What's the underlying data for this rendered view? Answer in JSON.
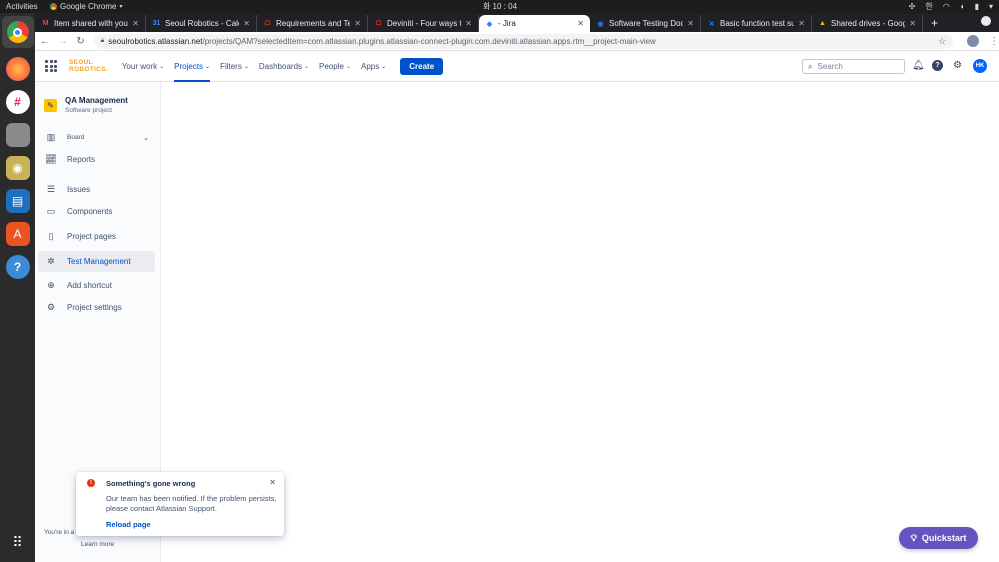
{
  "os": {
    "activities": "Activities",
    "app_name": "Google Chrome",
    "clock": "화 10 : 04",
    "lang": "한"
  },
  "tabs": [
    {
      "title": "Item shared with you",
      "favicon": "M",
      "color": "#ea4335"
    },
    {
      "title": "Seoul Robotics - Calen",
      "favicon": "31",
      "color": "#4285f4"
    },
    {
      "title": "Requirements and Te",
      "favicon": "ᗝ",
      "color": "#e2261d"
    },
    {
      "title": "Deviniti - Four ways t",
      "favicon": "ᗝ",
      "color": "#e2261d"
    },
    {
      "title": "- Jira",
      "favicon": "◆",
      "color": "#2684ff",
      "active": true
    },
    {
      "title": "Software Testing Doc",
      "favicon": "◉",
      "color": "#1a73e8"
    },
    {
      "title": "Basic function test su",
      "favicon": "✕",
      "color": "#2684ff"
    },
    {
      "title": "Shared drives - Googl",
      "favicon": "▲",
      "color": "#fbbc04"
    }
  ],
  "address": {
    "domain": "seoulrobotics.atlassian.net",
    "path": "/projects/QAM?selectedItem=com.atlassian.plugins.atlassian-connect-plugin:com.deviniti.atlassian.apps.rtm__project-main-view"
  },
  "header": {
    "logo_line1": "SEOUL",
    "logo_line2": "ROBOTICS.",
    "nav": [
      {
        "label": "Your work"
      },
      {
        "label": "Projects",
        "active": true
      },
      {
        "label": "Filters"
      },
      {
        "label": "Dashboards"
      },
      {
        "label": "People"
      },
      {
        "label": "Apps"
      }
    ],
    "create_label": "Create",
    "search_placeholder": "Search",
    "avatar_initials": "HK"
  },
  "sidebar": {
    "project_name": "QA Management",
    "project_type": "Software project",
    "items": [
      {
        "label": "Board",
        "icon": "board-icon"
      },
      {
        "label": "Reports",
        "icon": "chart-icon"
      },
      {
        "label": "Issues",
        "icon": "issues-icon"
      },
      {
        "label": "Components",
        "icon": "components-icon"
      },
      {
        "label": "Project pages",
        "icon": "page-icon"
      },
      {
        "label": "Test Management",
        "icon": "bug-icon",
        "selected": true
      },
      {
        "label": "Add shortcut",
        "icon": "add-shortcut-icon"
      },
      {
        "label": "Project settings",
        "icon": "gear-icon"
      }
    ],
    "footer_text": "You're in a c",
    "learn_more": "Learn more"
  },
  "toast": {
    "title": "Something's gone wrong",
    "body": "Our team has been notified. If the problem persists, please contact Atlassian Support.",
    "action": "Reload page"
  },
  "quickstart_label": "Quickstart"
}
